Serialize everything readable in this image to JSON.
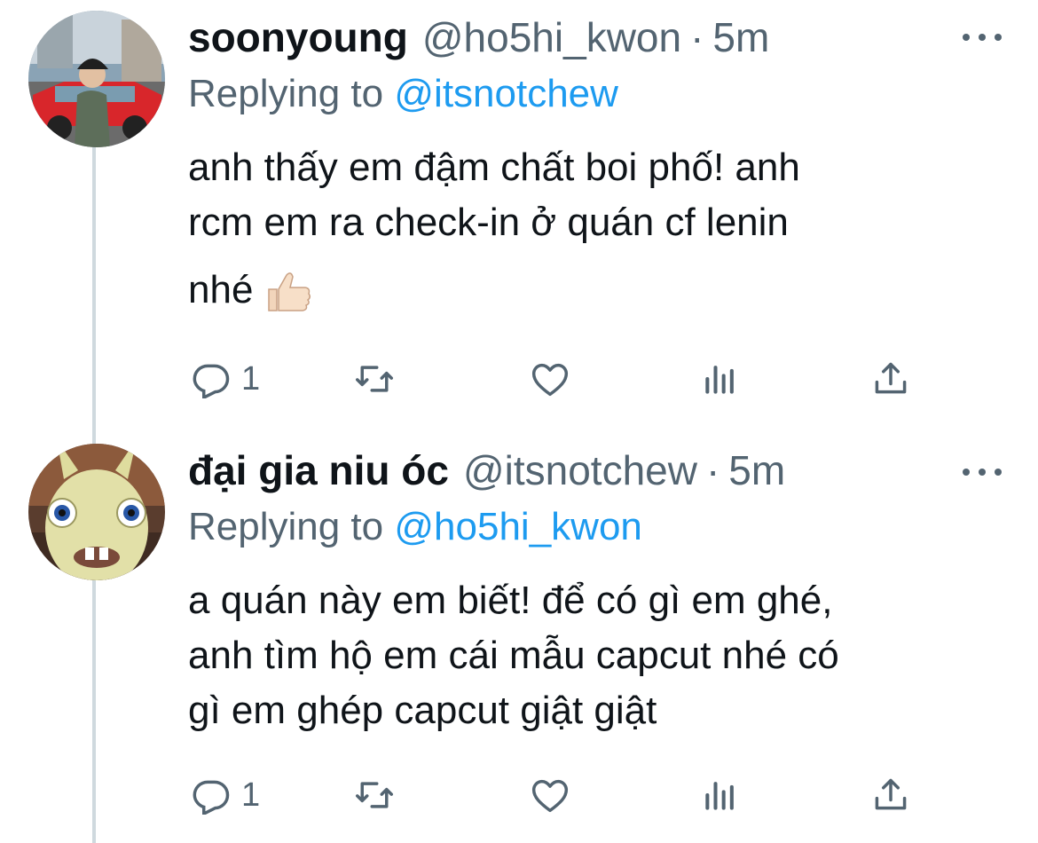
{
  "tweets": [
    {
      "name": "soonyoung",
      "handle": "@ho5hi_kwon",
      "separator": "·",
      "time": "5m",
      "replying_prefix": "Replying to",
      "replying_to": "@itsnotchew",
      "text_lines": [
        "anh thấy em đậm chất boi phố! anh",
        "rcm em ra check-in ở quán cf lenin",
        "nhé"
      ],
      "emoji": "thumbs-up",
      "reply_count": "1",
      "avatar": "person-street-photo"
    },
    {
      "name": "đại gia niu óc",
      "handle": "@itsnotchew",
      "separator": "·",
      "time": "5m",
      "replying_prefix": "Replying to",
      "replying_to": "@ho5hi_kwon",
      "text_lines": [
        "a quán này em biết! để có gì em ghé,",
        "anh tìm hộ em cái mẫu capcut nhé có",
        "gì em ghép capcut giật giật"
      ],
      "reply_count": "1",
      "avatar": "rabbid-character"
    }
  ],
  "icons": [
    "reply-icon",
    "retweet-icon",
    "like-icon",
    "analytics-icon",
    "share-icon",
    "more-icon"
  ],
  "colors": {
    "link": "#1d9bf0",
    "secondary": "#536471",
    "text": "#0f1419",
    "thread_line": "#cfd9de"
  }
}
